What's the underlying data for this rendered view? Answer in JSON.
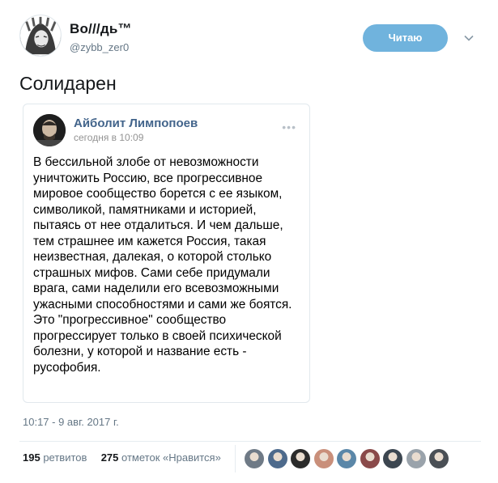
{
  "author": {
    "name": "Во///дь™",
    "handle": "@zybb_zer0",
    "follow_label": "Читаю"
  },
  "tweet": {
    "text": "Солидарен",
    "timestamp": "10:17 - 9 авг. 2017 г."
  },
  "embedded_post": {
    "author": "Айболит Лимпопоев",
    "time": "сегодня в 10:09",
    "more": "•••",
    "body": "В бессильной злобе от невозможности уничтожить Россию, все прогрессивное мировое сообщество борется с ее языком, символикой, памятниками и историей, пытаясь от нее отдалиться. И чем дальше, тем страшнее им кажется Россия, такая неизвестная, далекая, о которой столько страшных мифов. Сами себе придумали врага, сами наделили его всевозможными ужасными способностями и сами же боятся. Это \"прогрессивное\" сообщество прогрессирует только в своей психической болезни, у которой и название есть - русофобия."
  },
  "stats": {
    "retweets_count": "195",
    "retweets_label": "ретвитов",
    "likes_count": "275",
    "likes_label": "отметок «Нравится»"
  },
  "likers": [
    {
      "color": "#6f7a86"
    },
    {
      "color": "#4d6a8c"
    },
    {
      "color": "#2b2b2b"
    },
    {
      "color": "#c98f7a"
    },
    {
      "color": "#5b87a8"
    },
    {
      "color": "#8a4a4a"
    },
    {
      "color": "#3c4650"
    },
    {
      "color": "#9aa3ab"
    },
    {
      "color": "#4a4f55"
    }
  ],
  "colors": {
    "follow_button": "#70b3dd",
    "vk_name": "#42648b",
    "secondary_text": "#657786"
  }
}
